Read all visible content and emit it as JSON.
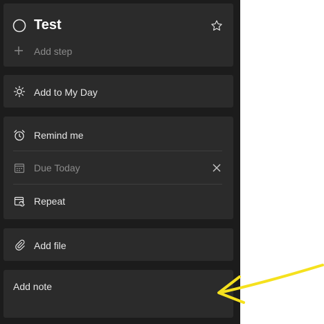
{
  "task": {
    "title": "Test",
    "add_step_label": "Add step"
  },
  "my_day": {
    "label": "Add to My Day"
  },
  "reminders": {
    "remind_label": "Remind me",
    "due_label": "Due Today",
    "repeat_label": "Repeat"
  },
  "file": {
    "label": "Add file"
  },
  "note": {
    "placeholder": "Add note"
  },
  "colors": {
    "pane_bg": "#1c1c1c",
    "card_bg": "#2b2b2b",
    "text": "#e6e6e6",
    "muted_text": "#8a8a8a",
    "annotation_arrow": "#f5e11e"
  },
  "icons": {
    "complete": "circle-checkbox-icon",
    "star": "star-icon",
    "add_step": "plus-icon",
    "my_day": "sun-icon",
    "remind": "alarm-clock-icon",
    "due": "calendar-icon",
    "remove_due": "close-icon",
    "repeat": "repeat-calendar-icon",
    "file": "paperclip-icon"
  }
}
